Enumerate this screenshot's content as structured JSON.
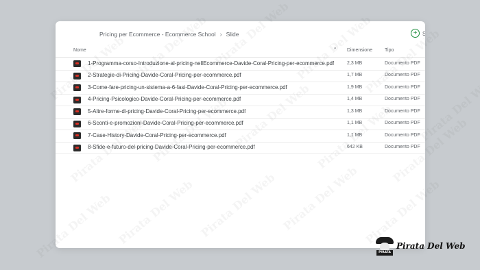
{
  "breadcrumb": {
    "items": [
      "Pricing per Ecommerce - Ecommerce School",
      "Slide"
    ],
    "separator": "›"
  },
  "toolbar": {
    "add_label": "S"
  },
  "table": {
    "headers": {
      "name": "Nome",
      "size": "Dimensione",
      "type": "Tipo"
    },
    "rows": [
      {
        "name": "1-Programma-corso-Introduzione-al-pricing-nellEcommerce-Davide-Coral-Pricing-per-ecommerce.pdf",
        "size": "2,3 MB",
        "type": "Documento PDF"
      },
      {
        "name": "2-Strategie-di-Pricing-Davide-Coral-Pricing-per-ecommerce.pdf",
        "size": "1,7 MB",
        "type": "Documento PDF"
      },
      {
        "name": "3-Come-fare-pricing-un-sistema-a-6-fasi-Davide-Coral-Pricing-per-ecommerce.pdf",
        "size": "1,9 MB",
        "type": "Documento PDF"
      },
      {
        "name": "4-Pricing-Psicologico-Davide-Coral-Pricing-per-ecommerce.pdf",
        "size": "1,4 MB",
        "type": "Documento PDF"
      },
      {
        "name": "5-Altre-forme-di-pricing-Davide-Coral-Pricing-per-ecommerce.pdf",
        "size": "1,3 MB",
        "type": "Documento PDF"
      },
      {
        "name": "6-Sconti-e-promozioni-Davide-Coral-Pricing-per-ecommerce.pdf",
        "size": "1,1 MB",
        "type": "Documento PDF"
      },
      {
        "name": "7-Case-History-Davide-Coral-Pricing-per-ecommerce.pdf",
        "size": "1,1 MB",
        "type": "Documento PDF"
      },
      {
        "name": "8-Sfide-e-futuro-del-pricing-Davide-Coral-Pricing-per-ecommerce.pdf",
        "size": "642 KB",
        "type": "Documento PDF"
      }
    ]
  },
  "watermark": {
    "text": "Pirata Del Web"
  },
  "logo": {
    "text": "Pirata Del Web",
    "badge": "PIRATA"
  },
  "colors": {
    "accent": "#1e8e3e",
    "pdf_red": "#d93025",
    "background": "#c7cbcf"
  }
}
